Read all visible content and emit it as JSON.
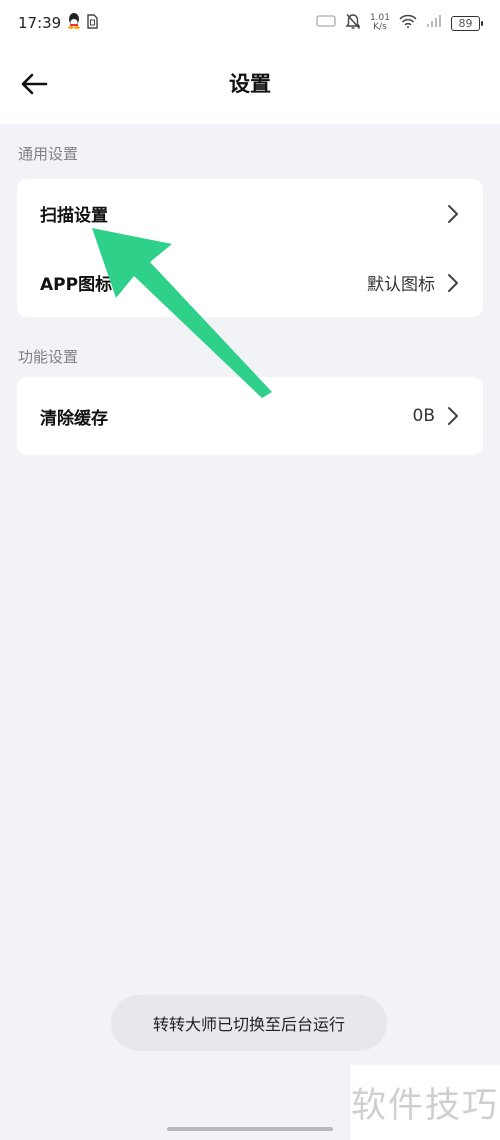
{
  "status_bar": {
    "time": "17:39",
    "net_speed_value": "1.01",
    "net_speed_unit": "K/s",
    "battery": "89"
  },
  "header": {
    "title": "设置"
  },
  "sections": [
    {
      "label": "通用设置",
      "items": [
        {
          "label": "扫描设置",
          "value": ""
        },
        {
          "label": "APP图标",
          "value": "默认图标"
        }
      ]
    },
    {
      "label": "功能设置",
      "items": [
        {
          "label": "清除缓存",
          "value": "0B"
        }
      ]
    }
  ],
  "toast": "转转大师已切换至后台运行",
  "watermark": "软件技巧",
  "colors": {
    "annotation_arrow": "#2fd08a",
    "background": "#f1f3f6",
    "card": "#ffffff"
  }
}
